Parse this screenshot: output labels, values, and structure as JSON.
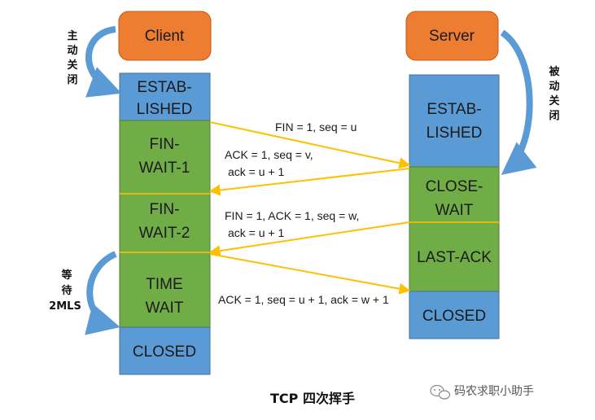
{
  "client": {
    "label": "Client"
  },
  "server": {
    "label": "Server"
  },
  "client_states": {
    "established_1": "ESTAB-",
    "established_2": "LISHED",
    "fin_wait_1_a": "FIN-",
    "fin_wait_1_b": "WAIT-1",
    "fin_wait_2_a": "FIN-",
    "fin_wait_2_b": "WAIT-2",
    "time_wait_a": "TIME",
    "time_wait_b": "WAIT",
    "closed": "CLOSED"
  },
  "server_states": {
    "established_1": "ESTAB-",
    "established_2": "LISHED",
    "close_wait_a": "CLOSE-",
    "close_wait_b": "WAIT",
    "last_ack": "LAST-ACK",
    "closed": "CLOSED"
  },
  "messages": {
    "m1": "FIN = 1, seq = u",
    "m2_a": "ACK = 1, seq = v,",
    "m2_b": "ack = u + 1",
    "m3_a": "FIN = 1, ACK = 1, seq = w,",
    "m3_b": "ack = u + 1",
    "m4": "ACK = 1, seq = u + 1, ack = w + 1"
  },
  "side_labels": {
    "active_close": [
      "主",
      "动",
      "关",
      "闭"
    ],
    "passive_close": [
      "被",
      "动",
      "关",
      "闭"
    ],
    "wait_2msl": [
      "等",
      "待",
      "2MLS"
    ]
  },
  "caption": "TCP 四次挥手",
  "watermark": "码农求职小助手",
  "colors": {
    "orange": "#ED7D31",
    "blue": "#5B9BD5",
    "green": "#70AD47",
    "arrow": "#FFC000",
    "curve": "#5B9BD5"
  }
}
